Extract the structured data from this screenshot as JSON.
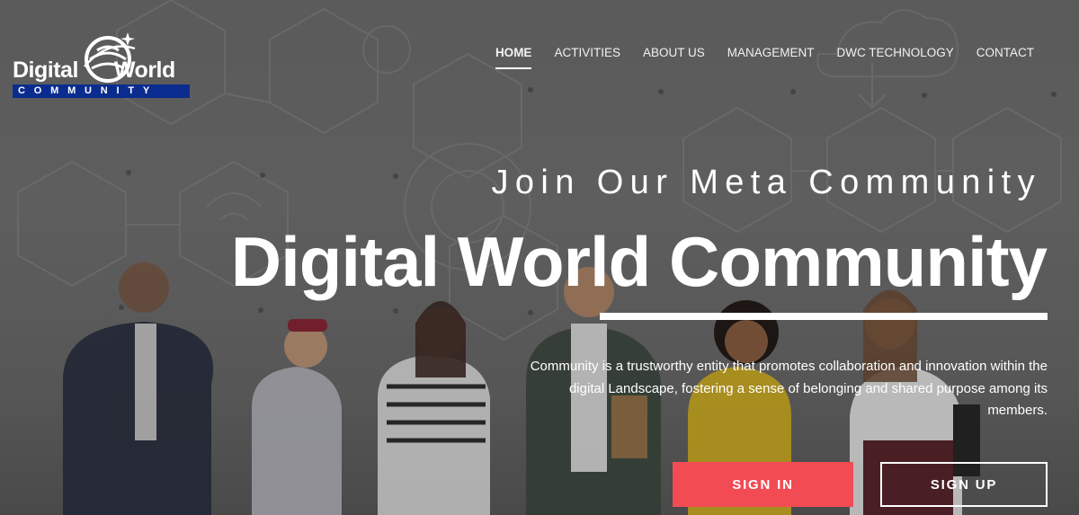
{
  "brand": {
    "name_part1": "Digital",
    "name_part2": "World",
    "band_text": "COMMUNITY",
    "band_color": "#0b2c8f",
    "icon": "globe-icon"
  },
  "nav": {
    "items": [
      {
        "label": "HOME",
        "active": true
      },
      {
        "label": "ACTIVITIES",
        "active": false
      },
      {
        "label": "ABOUT US",
        "active": false
      },
      {
        "label": "MANAGEMENT",
        "active": false
      },
      {
        "label": "DWC TECHNOLOGY",
        "active": false
      },
      {
        "label": "CONTACT",
        "active": false
      }
    ]
  },
  "hero": {
    "tagline": "Join Our Meta Community",
    "headline": "Digital World Community",
    "description": "Community is a trustworthy entity that promotes collaboration and innovation within the digital Landscape, fostering a sense of belonging and shared purpose among its members.",
    "signin_label": "SIGN IN",
    "signup_label": "SIGN UP"
  },
  "colors": {
    "accent": "#f24b54",
    "text": "#ffffff"
  }
}
